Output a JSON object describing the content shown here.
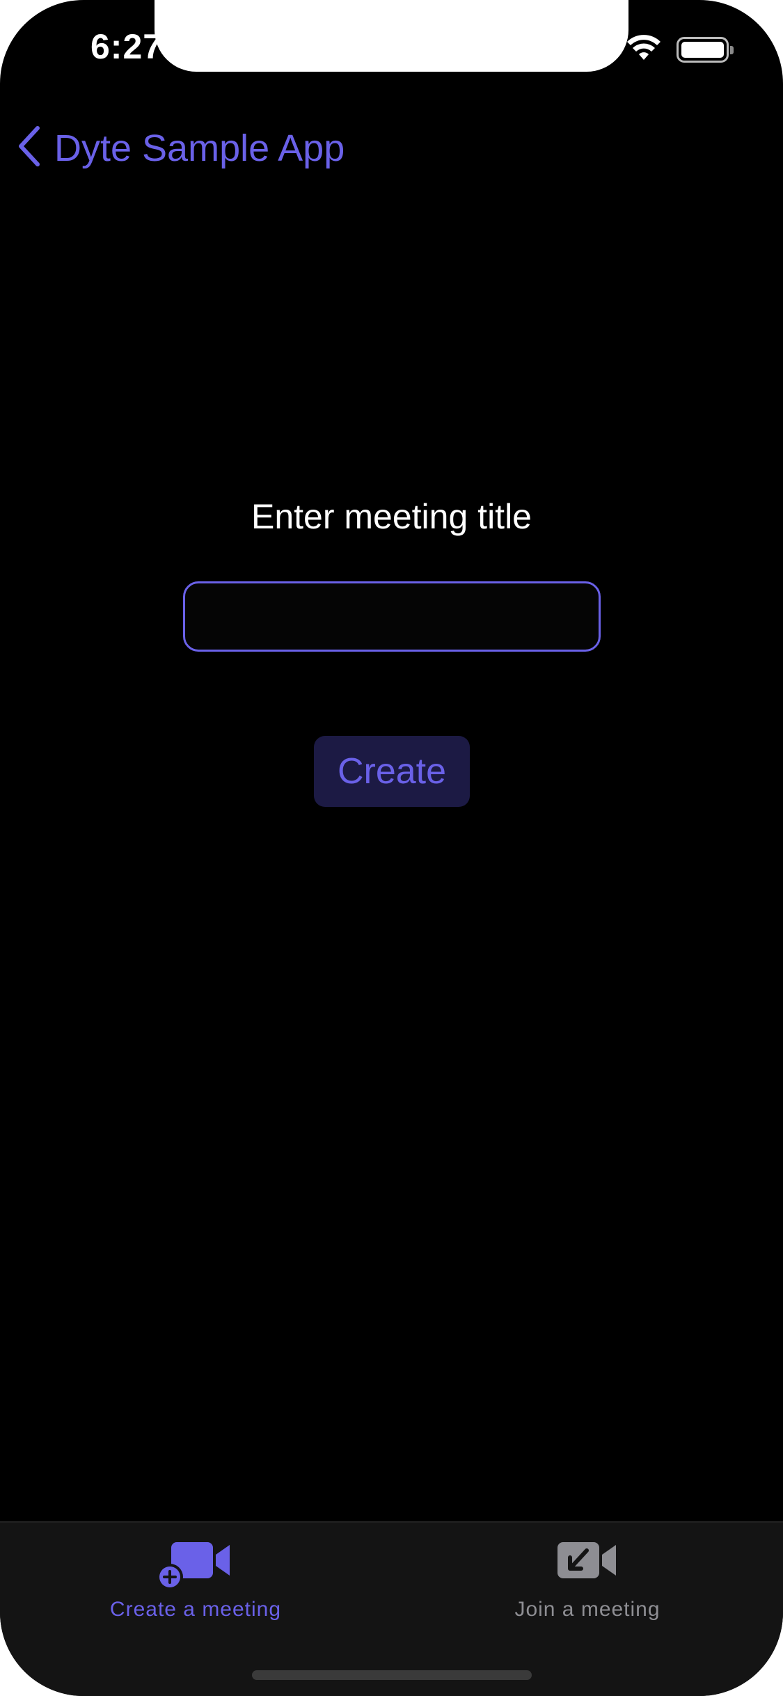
{
  "status_bar": {
    "time": "6:27"
  },
  "nav": {
    "back_label": "Dyte Sample App"
  },
  "form": {
    "prompt": "Enter meeting title",
    "input_value": "",
    "create_label": "Create"
  },
  "tabs": [
    {
      "label": "Create a meeting",
      "icon": "video-plus-icon",
      "selected": true
    },
    {
      "label": "Join a meeting",
      "icon": "video-arrow-icon",
      "selected": false
    }
  ],
  "colors": {
    "accent": "#6a61e8",
    "background": "#000000",
    "tab_bar": "#141414",
    "inactive": "#8e8e93",
    "button_bg": "#1c1a44"
  }
}
